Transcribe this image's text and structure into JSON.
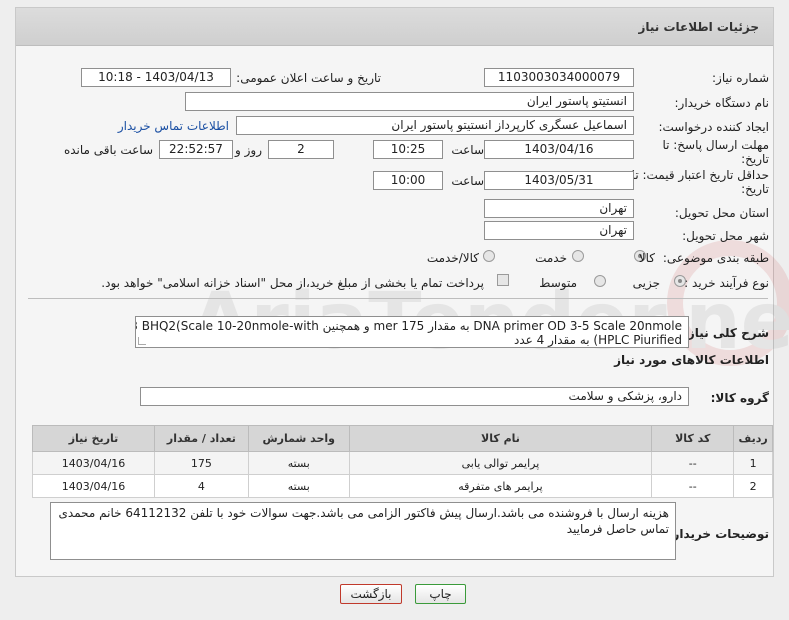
{
  "panel": {
    "title": "جزئیات اطلاعات نیاز"
  },
  "form": {
    "need_number_label": "شماره نیاز:",
    "need_number": "1103003034000079",
    "announce_label": "تاریخ و ساعت اعلان عمومی:",
    "announce_value": "1403/04/13 - 10:18",
    "buyer_org_label": "نام دستگاه خریدار:",
    "buyer_org": "انستیتو پاستور ایران",
    "requester_label": "ایجاد کننده درخواست:",
    "requester": "اسماعیل عسگری کارپرداز انستیتو پاستور ایران",
    "contact_link": "اطلاعات تماس خریدار",
    "deadline_label_1": "مهلت ارسال پاسخ: تا",
    "deadline_label_2": "تاریخ:",
    "deadline_date": "1403/04/16",
    "time_label": "ساعت",
    "deadline_time": "10:25",
    "days_value": "2",
    "days_label": "روز و",
    "remaining_time": "22:52:57",
    "remaining_label": "ساعت باقی مانده",
    "validity_label_1": "حداقل تاریخ اعتبار قیمت: تا",
    "validity_label_2": "تاریخ:",
    "validity_date": "1403/05/31",
    "validity_time": "10:00",
    "province_label": "استان محل تحویل:",
    "province": "تهران",
    "city_label": "شهر محل تحویل:",
    "city": "تهران",
    "category_label": "طبقه بندی موضوعی:",
    "category_options": [
      "کالا",
      "خدمت",
      "کالا/خدمت"
    ],
    "process_label": "نوع فرآیند خرید :",
    "process_options": [
      "جزیی",
      "متوسط"
    ],
    "payment_note": "پرداخت تمام یا بخشی از مبلغ خرید،از محل \"اسناد خزانه اسلامی\" خواهد بود."
  },
  "description": {
    "label": "شرح کلی نیاز:",
    "line1": "DNA primer OD 3-5 Scale 20nmole به مقدار 175 mer و همچنین HEX-5-3 BHQ2(Scale 10-20nmole-with",
    "line2": "HPLC Piurified) به مقدار 4 عدد"
  },
  "goods": {
    "section_title": "اطلاعات کالاهای مورد نیاز",
    "group_label": "گروه کالا:",
    "group_value": "دارو، پزشکی و سلامت",
    "columns": [
      "ردیف",
      "کد کالا",
      "نام کالا",
      "واحد شمارش",
      "تعداد / مقدار",
      "تاریخ نیاز"
    ],
    "rows": [
      [
        "1",
        "--",
        "پرایمر توالی یابی",
        "بسته",
        "175",
        "1403/04/16"
      ],
      [
        "2",
        "--",
        "پرایمر های متفرقه",
        "بسته",
        "4",
        "1403/04/16"
      ]
    ]
  },
  "buyer_notes": {
    "label": "توضیحات خریدار:",
    "text": "هزینه ارسال با فروشنده می باشد.ارسال پیش فاکتور الزامی می باشد.جهت سوالات خود با تلفن 64112132 خانم محمدی تماس حاصل فرمایید"
  },
  "buttons": {
    "print": "چاپ",
    "back": "بازگشت"
  },
  "watermark": {
    "text": "AriaTender.neT"
  },
  "colors": {
    "link": "#1a4fa3",
    "print_border": "#3a9a3a",
    "back_border": "#c0392b"
  }
}
